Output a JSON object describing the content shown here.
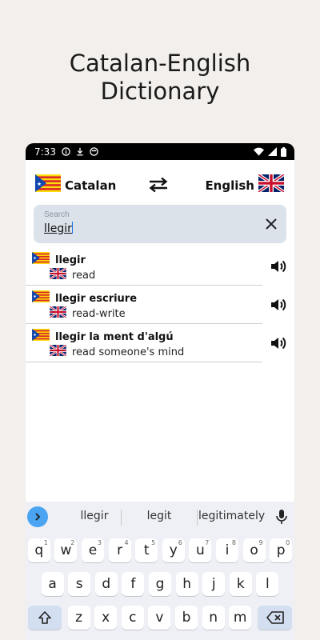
{
  "promo": {
    "line1": "Catalan-English",
    "line2": "Dictionary"
  },
  "status_bar": {
    "time": "7:33"
  },
  "language_bar": {
    "source_language": "Catalan",
    "target_language": "English"
  },
  "search": {
    "placeholder": "Search",
    "value": "llegir"
  },
  "results": [
    {
      "term": "llegir",
      "translation": "read"
    },
    {
      "term": "llegir escriure",
      "translation": "read-write"
    },
    {
      "term": "llegir la ment d'algú",
      "translation": "read someone's mind"
    }
  ],
  "keyboard": {
    "suggestions": [
      "llegir",
      "legit",
      "legitimately"
    ],
    "row1": [
      {
        "k": "q",
        "h": "1"
      },
      {
        "k": "w",
        "h": "2"
      },
      {
        "k": "e",
        "h": "3"
      },
      {
        "k": "r",
        "h": "4"
      },
      {
        "k": "t",
        "h": "5"
      },
      {
        "k": "y",
        "h": "6"
      },
      {
        "k": "u",
        "h": "7"
      },
      {
        "k": "i",
        "h": "8"
      },
      {
        "k": "o",
        "h": "9"
      },
      {
        "k": "p",
        "h": "0"
      }
    ],
    "row2": [
      "a",
      "s",
      "d",
      "f",
      "g",
      "h",
      "j",
      "k",
      "l"
    ],
    "row3": [
      "z",
      "x",
      "c",
      "v",
      "b",
      "n",
      "m"
    ]
  },
  "colors": {
    "accent_blue": "#4aa4f2",
    "search_bg": "#dbe2ea",
    "catalan_red": "#d9252a",
    "catalan_yellow": "#fcdd09"
  }
}
